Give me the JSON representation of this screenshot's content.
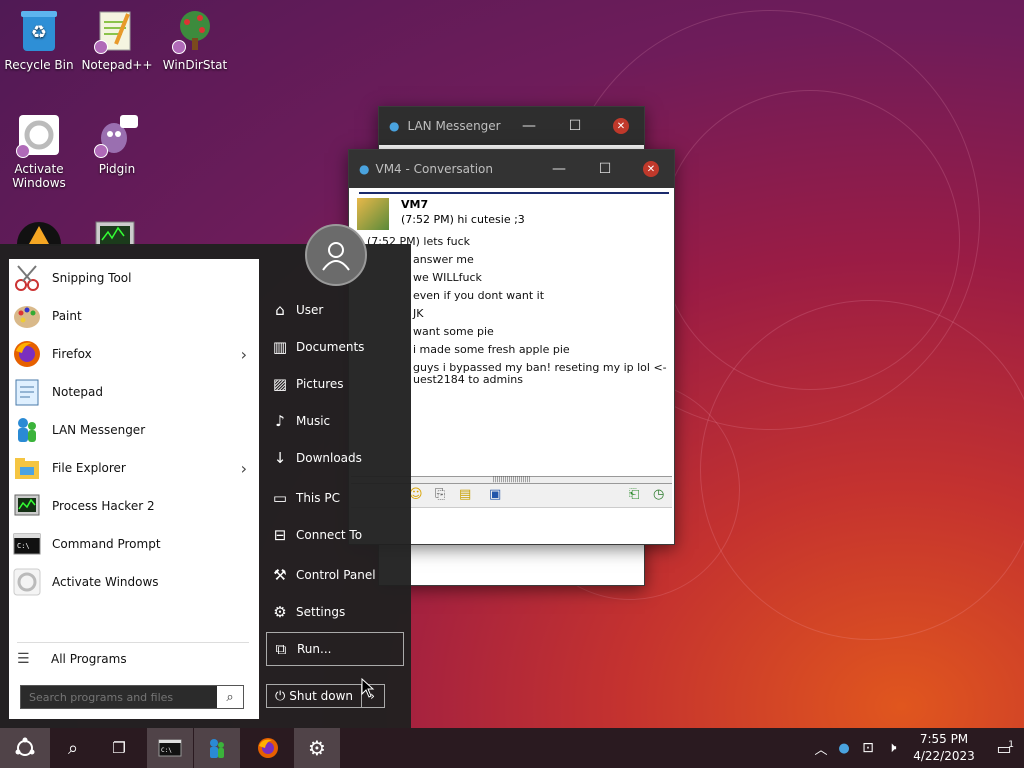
{
  "desktop": {
    "icons": [
      {
        "label": "Recycle Bin",
        "icon": "recycle-bin-icon"
      },
      {
        "label": "Notepad++",
        "icon": "notepadpp-icon"
      },
      {
        "label": "WinDirStat",
        "icon": "windirstat-icon"
      },
      {
        "label": "Activate Windows",
        "icon": "activate-windows-icon"
      },
      {
        "label": "Pidgin",
        "icon": "pidgin-icon"
      }
    ]
  },
  "lan_window": {
    "title": "LAN Messenger"
  },
  "conversation": {
    "title": "VM4 - Conversation",
    "sender": "VM7",
    "first_msg": "(7:52 PM) hi cutesie ;3",
    "messages": [
      "(7:52 PM) lets fuck",
      "answer me",
      "we WILLfuck",
      "even if you dont want it",
      "JK",
      "want some pie",
      "i made some fresh apple pie",
      "guys i bypassed my ban! reseting my ip lol <-",
      "uest2184 to admins"
    ]
  },
  "start_menu": {
    "programs": [
      {
        "label": "Snipping Tool",
        "icon": "snipping-tool-icon",
        "submenu": false
      },
      {
        "label": "Paint",
        "icon": "paint-icon",
        "submenu": false
      },
      {
        "label": "Firefox",
        "icon": "firefox-icon",
        "submenu": true
      },
      {
        "label": "Notepad",
        "icon": "notepad-icon",
        "submenu": false
      },
      {
        "label": "LAN Messenger",
        "icon": "lan-messenger-icon",
        "submenu": false
      },
      {
        "label": "File Explorer",
        "icon": "file-explorer-icon",
        "submenu": true
      },
      {
        "label": "Process Hacker 2",
        "icon": "process-hacker-icon",
        "submenu": false
      },
      {
        "label": "Command Prompt",
        "icon": "command-prompt-icon",
        "submenu": false
      },
      {
        "label": "Activate Windows",
        "icon": "activate-windows-icon",
        "submenu": false
      }
    ],
    "all_programs": "All Programs",
    "search_placeholder": "Search programs and files",
    "right_items": [
      {
        "label": "User",
        "icon": "user-icon"
      },
      {
        "label": "Documents",
        "icon": "documents-icon"
      },
      {
        "label": "Pictures",
        "icon": "pictures-icon"
      },
      {
        "label": "Music",
        "icon": "music-icon"
      },
      {
        "label": "Downloads",
        "icon": "downloads-icon"
      },
      {
        "label": "This PC",
        "icon": "this-pc-icon"
      },
      {
        "label": "Connect To",
        "icon": "connect-to-icon"
      },
      {
        "label": "Control Panel",
        "icon": "control-panel-icon"
      },
      {
        "label": "Settings",
        "icon": "settings-icon"
      },
      {
        "label": "Run...",
        "icon": "run-icon"
      }
    ],
    "shutdown": "Shut down"
  },
  "taskbar": {
    "time": "7:55 PM",
    "date": "4/22/2023",
    "notification_count": "1"
  },
  "colors": {
    "accent": "#c4322f",
    "taskbar": "#2a1a20",
    "start_bg": "#202020"
  }
}
